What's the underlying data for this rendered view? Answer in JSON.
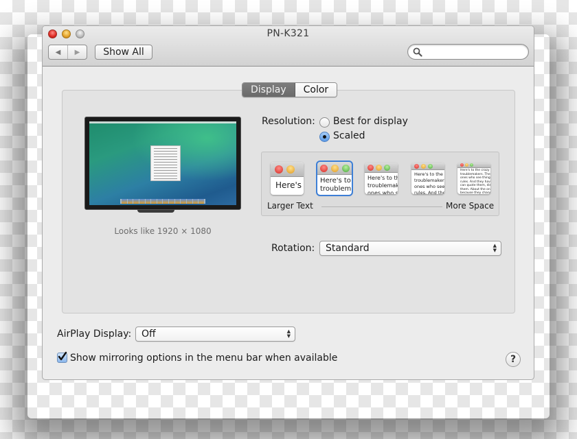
{
  "window": {
    "title": "PN-K321",
    "controls": [
      "close",
      "minimize",
      "zoom"
    ]
  },
  "toolbar": {
    "back_icon": "◀",
    "forward_icon": "▶",
    "show_all_label": "Show All",
    "search_placeholder": "",
    "search_value": ""
  },
  "tabs": [
    {
      "label": "Display",
      "active": true
    },
    {
      "label": "Color",
      "active": false
    }
  ],
  "display": {
    "preview_caption": "Looks like 1920 × 1080",
    "resolution_label": "Resolution:",
    "resolution_options": [
      {
        "label": "Best for display",
        "selected": false
      },
      {
        "label": "Scaled",
        "selected": true
      }
    ],
    "scale_options": [
      {
        "sample_text": "Here's",
        "selected": false
      },
      {
        "sample_text": "Here's to\ntroublem",
        "selected": true
      },
      {
        "sample_text": "Here's to th\ntroublemak\nones who s",
        "selected": false
      },
      {
        "sample_text": "Here's to the cr\ntroublemakers.\nones who see t\nrules. And they",
        "selected": false
      },
      {
        "sample_text": "Here's to the crazy one\ntroublemakers. The rou\nones who see things dif\nrules. And they have no\ncan quote them, disagre\nthem. About the only th\nbecause they change th",
        "selected": false
      }
    ],
    "scale_min_label": "Larger Text",
    "scale_max_label": "More Space",
    "rotation_label": "Rotation:",
    "rotation_value": "Standard"
  },
  "footer": {
    "airplay_label": "AirPlay Display:",
    "airplay_value": "Off",
    "mirroring_checkbox_label": "Show mirroring options in the menu bar when available",
    "mirroring_checked": true,
    "help_label": "?"
  },
  "icons": {
    "popup_arrows": "▲\n▼",
    "checkmark": "✔"
  }
}
